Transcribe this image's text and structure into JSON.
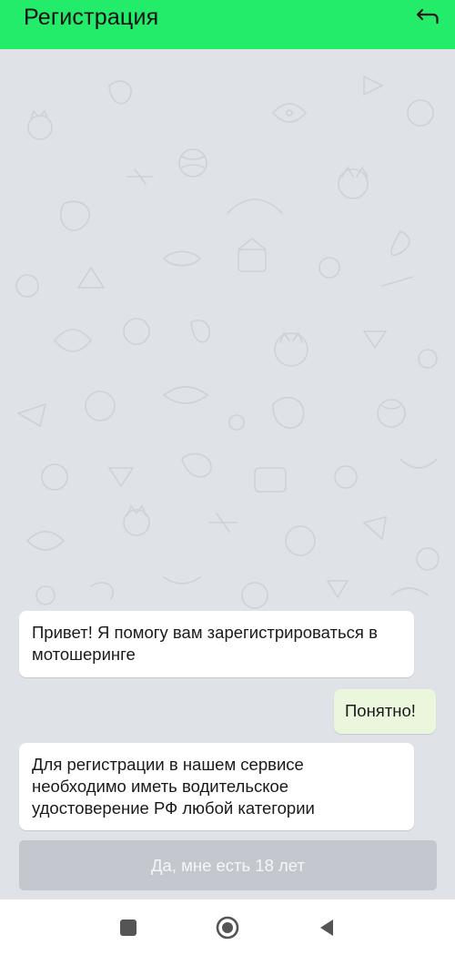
{
  "app_bar": {
    "title": "Регистрация",
    "back_icon": "undo-arrow-icon",
    "color": "#22ec6a"
  },
  "chat": {
    "background_color": "#dfe3e8",
    "messages": [
      {
        "sender": "bot",
        "text": "Привет! Я помогу вам зарегистрироваться в мотошеринге"
      },
      {
        "sender": "user",
        "text": "Понятно!"
      },
      {
        "sender": "bot",
        "text": "Для регистрации в нашем сервисе необходимо иметь водительское удостоверение РФ любой категории"
      }
    ]
  },
  "quick_reply": {
    "label": "Да, мне есть 18 лет",
    "enabled": false
  },
  "system_nav": {
    "recents_icon": "square-icon",
    "home_icon": "circle-home-icon",
    "back_icon": "triangle-back-icon"
  }
}
